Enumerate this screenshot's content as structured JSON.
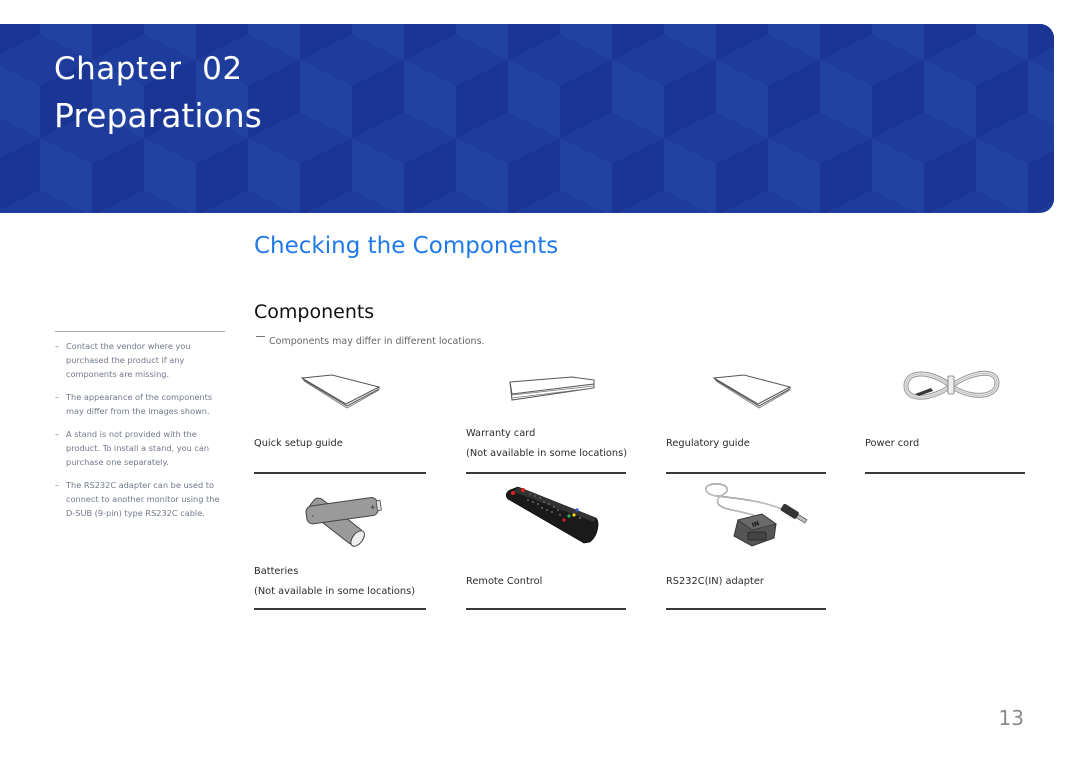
{
  "header": {
    "chapter_label": "Chapter  02",
    "chapter_title": "Preparations",
    "colors": {
      "banner": "#1d3c9b",
      "cube_light": "#2142a0",
      "cube_dark": "#1a3594"
    }
  },
  "section": {
    "title": "Checking the Components",
    "title_color": "#1f7ae8",
    "subtitle": "Components",
    "note": "Components may differ in different locations."
  },
  "sidebar": {
    "notes": [
      {
        "bullet": "–",
        "text": "Contact the vendor where you purchased the product if any components are missing."
      },
      {
        "bullet": "–",
        "text": "The appearance of the components may differ from the images shown."
      },
      {
        "bullet": "–",
        "text": "A stand is not provided with the product. To install a stand, you can purchase one separately."
      },
      {
        "bullet": "–",
        "text": "The RS232C adapter can be used to connect to another monitor using the D-SUB (9-pin) type RS232C cable."
      }
    ]
  },
  "components": [
    {
      "name": "Quick setup guide",
      "note": "",
      "icon": "booklet-icon"
    },
    {
      "name": "Warranty card",
      "note": "(Not available in some locations)",
      "icon": "card-icon"
    },
    {
      "name": "Regulatory guide",
      "note": "",
      "icon": "booklet-icon"
    },
    {
      "name": "Power cord",
      "note": "",
      "icon": "power-cord-icon"
    },
    {
      "name": "Batteries",
      "note": "(Not available in some locations)",
      "icon": "batteries-icon"
    },
    {
      "name": "Remote Control",
      "note": "",
      "icon": "remote-control-icon"
    },
    {
      "name": "RS232C(IN) adapter",
      "note": "",
      "icon": "rs232c-adapter-icon"
    }
  ],
  "footer": {
    "page_number": "13"
  }
}
